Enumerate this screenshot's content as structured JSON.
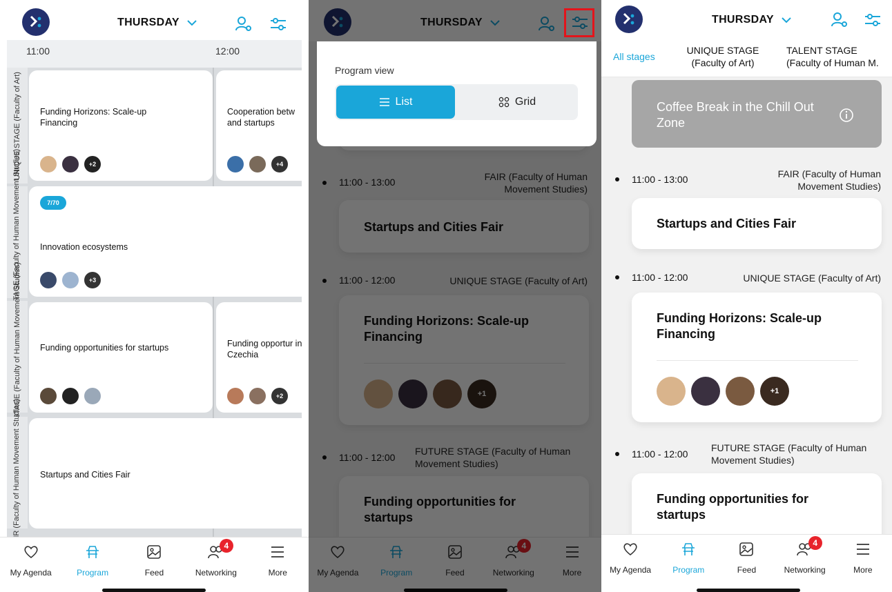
{
  "header": {
    "day": "THURSDAY"
  },
  "grid": {
    "times": [
      "11:00",
      "12:00"
    ],
    "stages": [
      "UNIQUE STAGE (Faculty of Art)",
      "TALENT STAGE (Faculty of Human Movement Studies)",
      "FUTURE STAGE (Faculty of Human Movement Studies)",
      "FAIR (Faculty of Human Movement Studies)"
    ],
    "cards": [
      {
        "title": "Funding Horizons: Scale-up Financing",
        "more": "+2"
      },
      {
        "title": "Cooperation betw and startups",
        "more": "+4"
      },
      {
        "badge": "7/70",
        "title": "Innovation ecosystems",
        "more": "+3"
      },
      {
        "title": "Funding opportunities for startups"
      },
      {
        "title": "Funding opportur in Czechia",
        "more": "+2"
      },
      {
        "title": "Startups and Cities Fair"
      }
    ]
  },
  "program_view": {
    "label": "Program view",
    "list": "List",
    "grid": "Grid"
  },
  "stage_tabs": {
    "all": "All stages",
    "unique": "UNIQUE STAGE (Faculty of Art)",
    "talent": "TALENT STAGE (Faculty of Human M."
  },
  "list": {
    "coffee": "Coffee Break in the Chill Out Zone",
    "items": [
      {
        "time": "11:00 - 13:00",
        "stage": "FAIR (Faculty of Human Movement Studies)",
        "title": "Startups and Cities Fair"
      },
      {
        "time": "11:00 - 12:00",
        "stage": "UNIQUE STAGE (Faculty of Art)",
        "title": "Funding Horizons: Scale-up Financing",
        "more": "+1"
      },
      {
        "time": "11:00 - 12:00",
        "stage": "FUTURE STAGE (Faculty of Human Movement Studies)",
        "title": "Funding opportunities for startups"
      }
    ]
  },
  "nav": {
    "items": [
      "My Agenda",
      "Program",
      "Feed",
      "Networking",
      "More"
    ],
    "badge": "4"
  },
  "colors": {
    "accent": "#1aa6d9",
    "brand": "#23306e",
    "badge": "#e8232b",
    "highlight": "#e4141b"
  }
}
